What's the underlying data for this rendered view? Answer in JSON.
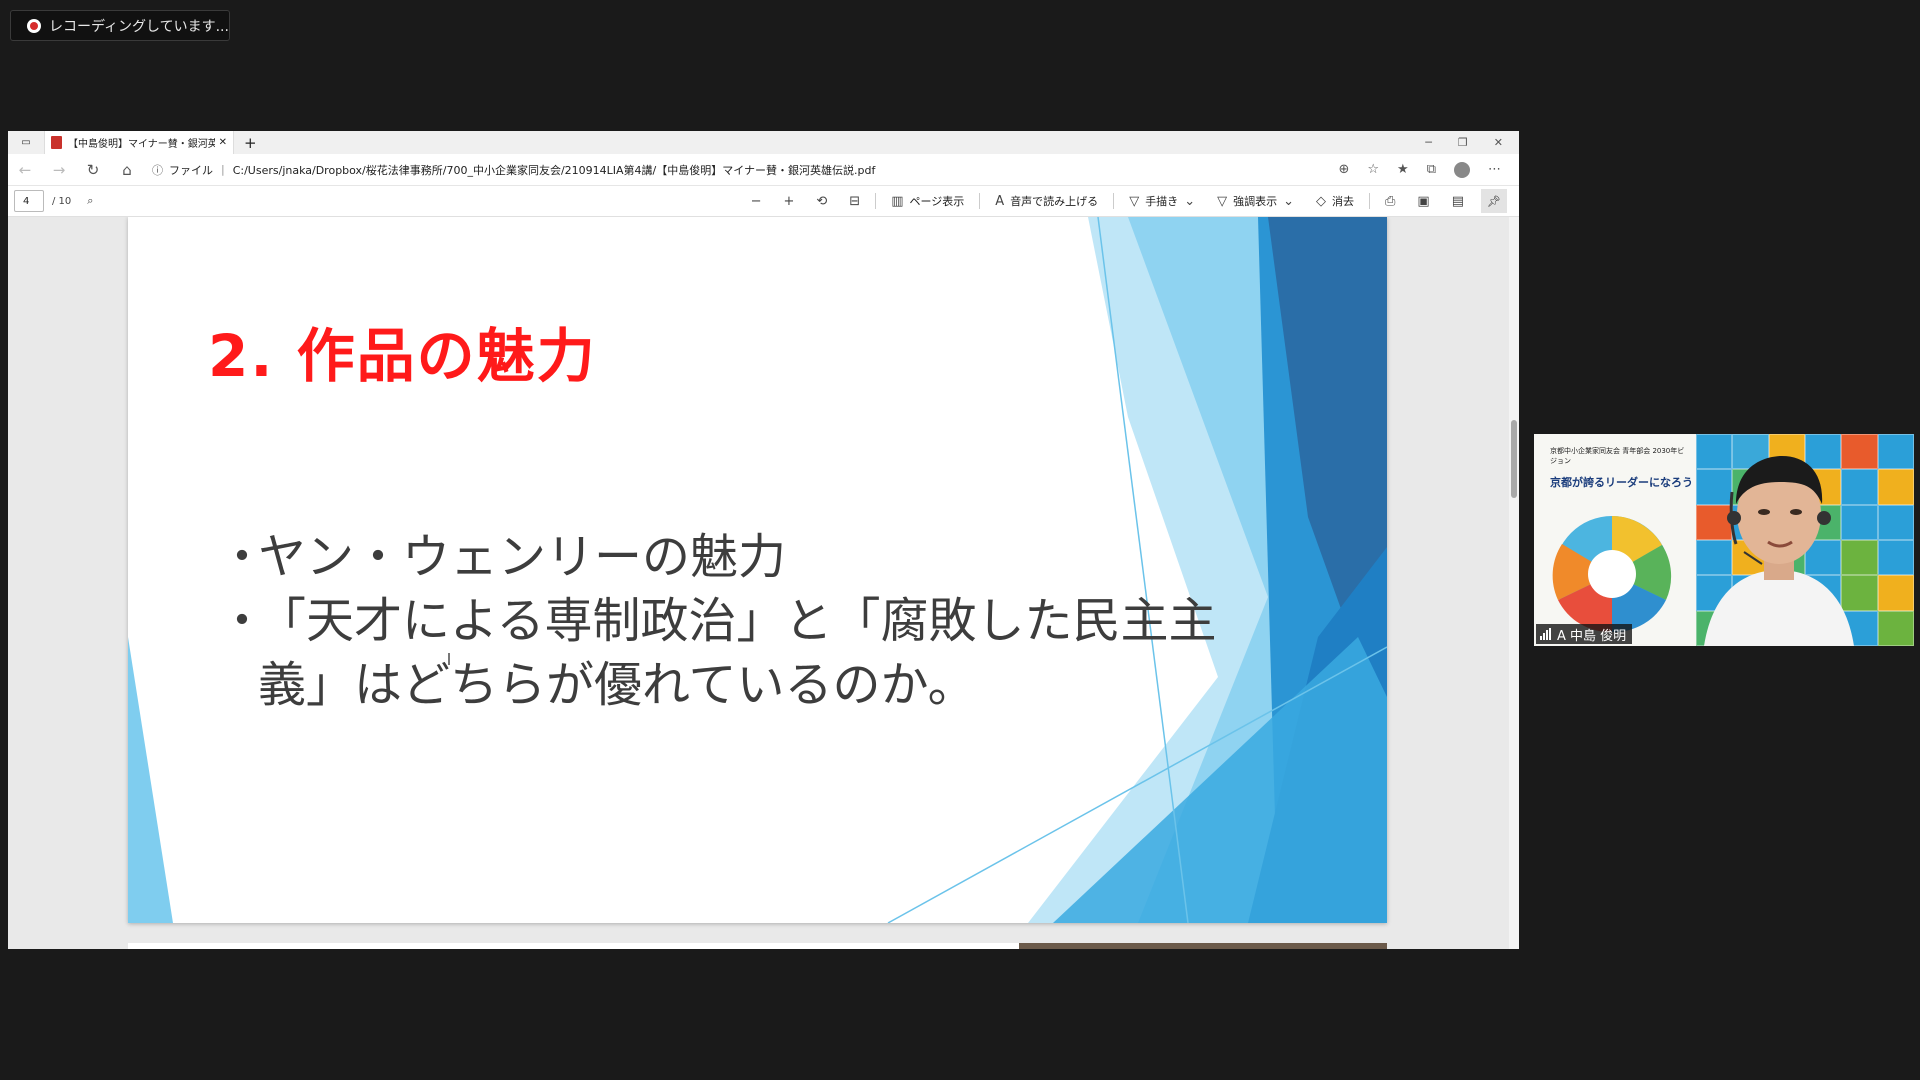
{
  "recording": {
    "label": "レコーディングしています..."
  },
  "browser": {
    "tab_title": "【中島俊明】マイナー賛・銀河英雄伝説.pdf",
    "new_tab": "+",
    "url_prefix": "ファイル",
    "url": "C:/Users/jnaka/Dropbox/桜花法律事務所/700_中小企業家同友会/210914LIA第4講/【中島俊明】マイナー賛・銀河英雄伝説.pdf"
  },
  "pdf_toolbar": {
    "page_current": "4",
    "page_total": "/ 10",
    "page_view": "ページ表示",
    "read_aloud": "音声で読み上げる",
    "draw": "手描き",
    "highlight": "強調表示",
    "erase": "消去"
  },
  "slide": {
    "title": "2. 作品の魅力",
    "bullets": [
      "ヤン・ウェンリーの魅力",
      "「天才による専制政治」と「腐敗した民主主義」はどちらが優れているのか。"
    ],
    "bullet_glyph": "・"
  },
  "video": {
    "participant_name": "A 中島 俊明",
    "poster_header": "京都中小企業家同友会 青年部会 2030年ビジョン",
    "poster_headline": "京都が誇るリーダーになろう"
  },
  "colors": {
    "title_red": "#ff1a1a",
    "slide_blue_light": "#9fd8f2",
    "slide_blue_mid": "#3aa9e0",
    "slide_blue_dark": "#1a5e96"
  }
}
